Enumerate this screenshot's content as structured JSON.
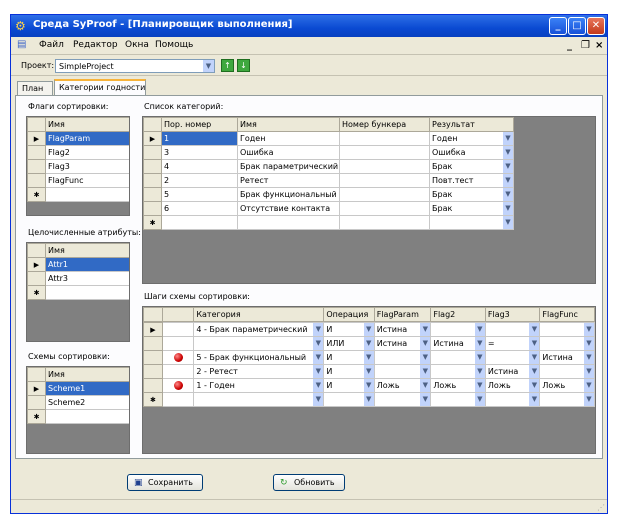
{
  "window": {
    "title": "Среда SyProof - [Планировщик выполнения]"
  },
  "menu": {
    "items": [
      "Файл",
      "Редактор",
      "Окна",
      "Помощь"
    ]
  },
  "project": {
    "label": "Проект:",
    "value": "SimpleProject"
  },
  "tabs": [
    "План",
    "Категории годности"
  ],
  "flags": {
    "label": "Флаги сортировки:",
    "header": "Имя",
    "rows": [
      "FlagParam",
      "Flag2",
      "Flag3",
      "FlagFunc"
    ]
  },
  "attrs": {
    "label": "Целочисленные атрибуты:",
    "header": "Имя",
    "rows": [
      "Attr1",
      "Attr3"
    ]
  },
  "schemes": {
    "label": "Схемы сортировки:",
    "header": "Имя",
    "rows": [
      "Scheme1",
      "Scheme2"
    ]
  },
  "categories": {
    "label": "Список категорий:",
    "headers": [
      "Пор. номер",
      "Имя",
      "Номер бункера",
      "Результат"
    ],
    "rows": [
      [
        "1",
        "Годен",
        "",
        "Годен"
      ],
      [
        "3",
        "Ошибка",
        "",
        "Ошибка"
      ],
      [
        "4",
        "Брак параметрический",
        "",
        "Брак"
      ],
      [
        "2",
        "Ретест",
        "",
        "Повт.тест"
      ],
      [
        "5",
        "Брак функциональный",
        "",
        "Брак"
      ],
      [
        "6",
        "Отсутствие контакта",
        "",
        "Брак"
      ]
    ]
  },
  "steps": {
    "label": "Шаги схемы сортировки:",
    "headers": [
      "Категория",
      "Операция",
      "FlagParam",
      "Flag2",
      "Flag3",
      "FlagFunc"
    ],
    "rows": [
      {
        "dot": false,
        "cells": [
          "4 - Брак параметрический",
          "И",
          "Истина",
          "",
          "",
          ""
        ]
      },
      {
        "dot": false,
        "cells": [
          "",
          "ИЛИ",
          "Истина",
          "Истина",
          "=",
          ""
        ]
      },
      {
        "dot": true,
        "cells": [
          "5 - Брак функциональный",
          "И",
          "",
          "",
          "",
          "Истина"
        ]
      },
      {
        "dot": false,
        "cells": [
          "2 - Ретест",
          "И",
          "",
          "",
          "Истина",
          ""
        ]
      },
      {
        "dot": true,
        "cells": [
          "1 - Годен",
          "И",
          "Ложь",
          "Ложь",
          "Ложь",
          "Ложь"
        ]
      }
    ]
  },
  "buttons": {
    "save": "Сохранить",
    "refresh": "Обновить"
  },
  "row_marker": "▶",
  "new_row_marker": "✱",
  "colors": {
    "title_bar": "#0a4ad2",
    "selection": "#316ac5",
    "grid_bg": "#808080"
  }
}
